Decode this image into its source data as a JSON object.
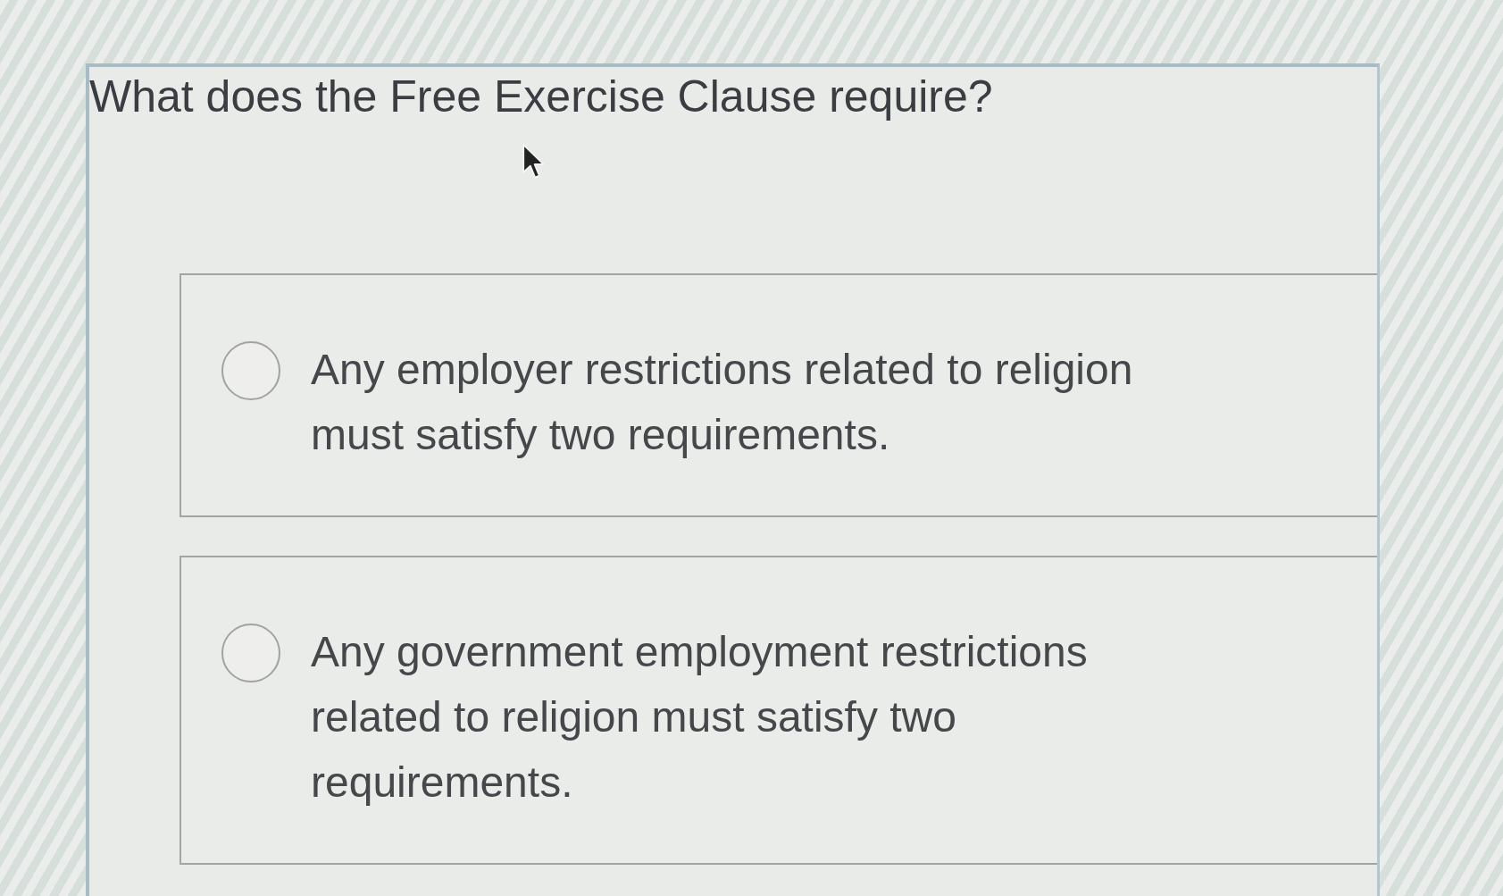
{
  "question": "What does the Free Exercise Clause require?",
  "options": [
    {
      "text": "Any employer restrictions related to religion must satisfy two requirements.",
      "selected": false
    },
    {
      "text": "Any government employment restrictions related to religion must satisfy two requirements.",
      "selected": false
    }
  ]
}
